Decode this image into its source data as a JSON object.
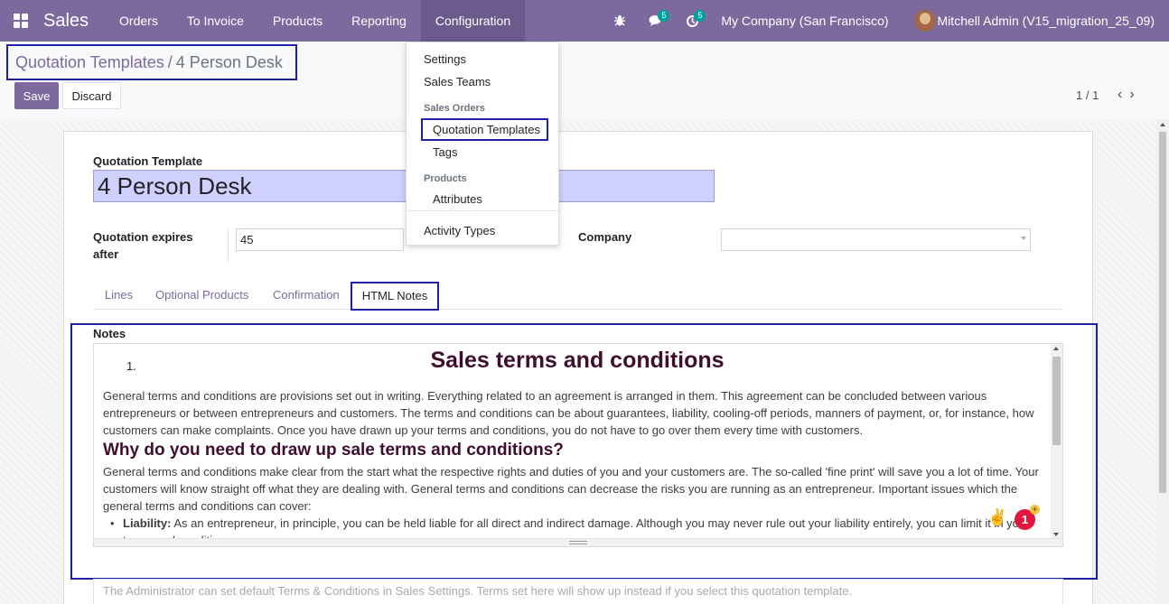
{
  "navbar": {
    "brand": "Sales",
    "menus": [
      "Orders",
      "To Invoice",
      "Products",
      "Reporting",
      "Configuration"
    ],
    "messages_count": "5",
    "activities_count": "5",
    "company": "My Company (San Francisco)",
    "user": "Mitchell Admin (V15_migration_25_09)"
  },
  "breadcrumb": {
    "parent": "Quotation Templates",
    "separator": "/",
    "current": "4 Person Desk"
  },
  "toolbar": {
    "save_label": "Save",
    "discard_label": "Discard",
    "pager": "1 / 1",
    "prev_arrow": "‹",
    "next_arrow": "›"
  },
  "form": {
    "name_label": "Quotation Template",
    "name_value": "4 Person Desk",
    "expires_label_line1": "Quotation expires",
    "expires_label_line2": "after",
    "expires_value": "45",
    "company_label": "Company",
    "company_value": ""
  },
  "tabs": [
    "Lines",
    "Optional Products",
    "Confirmation",
    "HTML Notes"
  ],
  "notes": {
    "label": "Notes",
    "list_number": "1.",
    "title": "Sales terms and conditions",
    "para1": "General terms and conditions are provisions set out in writing. Everything related to an agreement is arranged in them. This agreement can be concluded between various entrepreneurs or between entrepreneurs and customers. The terms and conditions can be about guarantees, liability, cooling-off periods, manners of payment, or, for instance, how customers can make complaints. Once you have drawn up your terms and conditions, you do not have to go over them every time with customers.",
    "heading2": "Why do you need to draw up sale terms and conditions?",
    "para2": "General terms and conditions make clear from the start what the respective rights and duties of you and your customers are. The so-called 'fine print' will save you a lot of time. Your customers will know straight off what they are dealing with. General terms and conditions can decrease the risks you are running as an entrepreneur. Important issues which the general terms and conditions can cover:",
    "bullet_label": "Liability:",
    "bullet_text": " As an entrepreneur, in principle, you can be held liable for all direct and indirect damage. Although you may never rule out your liability entirely, you can limit it in your terms and conditions."
  },
  "notifications": {
    "emoji": "✌",
    "count": "1",
    "plus": "+"
  },
  "terms_placeholder": "The Administrator can set default Terms & Conditions in Sales Settings. Terms set here will show up instead if you select this quotation template.",
  "dropdown": {
    "settings": "Settings",
    "sales_teams": "Sales Teams",
    "header_sales_orders": "Sales Orders",
    "quotation_templates": "Quotation Templates",
    "tags": "Tags",
    "header_products": "Products",
    "attributes": "Attributes",
    "activity_types": "Activity Types"
  },
  "colors": {
    "brand": "#7c6a9f",
    "highlight_box": "#1d1fa8",
    "heading": "#3f0e2e",
    "name_field_bg": "#cfd0fb"
  }
}
